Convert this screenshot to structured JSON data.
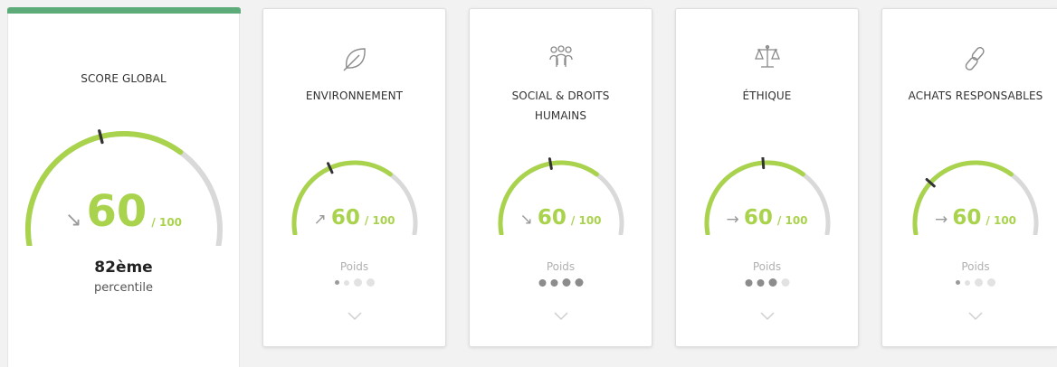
{
  "global": {
    "title": "SCORE GLOBAL",
    "trend_icon": "arrow-down-right-icon",
    "trend_glyph": "↘",
    "score": "60",
    "max": "/ 100",
    "score_value": 60,
    "percentile_rank": "82ème",
    "percentile_label": "percentile"
  },
  "colors": {
    "gauge_fill": "#a9d34d",
    "gauge_track": "#d9d9d9",
    "marker": "#333333",
    "header_bar": "#5cab78"
  },
  "cards": [
    {
      "id": "environnement",
      "title_lines": [
        "ENVIRONNEMENT"
      ],
      "icon": "leaf-icon",
      "trend_icon": "arrow-up-right-icon",
      "trend_glyph": "↗",
      "score": "60",
      "max": "/ 100",
      "fill_value": 68,
      "marker_value": 38,
      "poids_label": "Poids",
      "weight_dots": [
        2,
        1,
        1,
        1
      ]
    },
    {
      "id": "social",
      "title_lines": [
        "SOCIAL & DROITS",
        "HUMAINS"
      ],
      "icon": "people-group-icon",
      "trend_icon": "arrow-down-right-icon",
      "trend_glyph": "↘",
      "score": "60",
      "max": "/ 100",
      "fill_value": 68,
      "marker_value": 45,
      "poids_label": "Poids",
      "weight_dots": [
        3,
        3,
        3,
        3
      ]
    },
    {
      "id": "ethique",
      "title_lines": [
        "ÉTHIQUE"
      ],
      "icon": "balance-scale-icon",
      "trend_icon": "arrow-right-icon",
      "trend_glyph": "→",
      "score": "60",
      "max": "/ 100",
      "fill_value": 68,
      "marker_value": 48,
      "poids_label": "Poids",
      "weight_dots": [
        3,
        3,
        3,
        1
      ]
    },
    {
      "id": "achats",
      "title_lines": [
        "ACHATS RESPONSABLES"
      ],
      "icon": "link-icon",
      "trend_icon": "arrow-right-icon",
      "trend_glyph": "→",
      "score": "60",
      "max": "/ 100",
      "fill_value": 68,
      "marker_value": 26,
      "poids_label": "Poids",
      "weight_dots": [
        2,
        1,
        1,
        1
      ]
    }
  ]
}
